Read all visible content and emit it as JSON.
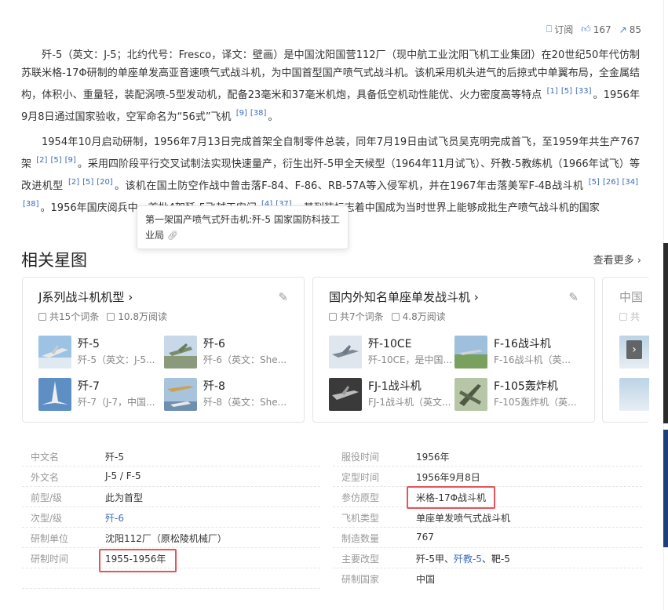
{
  "actions": {
    "subscribe": "订阅",
    "likes": "167",
    "shares": "85"
  },
  "para1": {
    "text_a": "歼-5（英文：J-5；北约代号：Fresco，译文：壁画）是中国沈阳国营112厂（现中航工业沈阳飞机工业集团）在20世纪50年代仿制苏联米格-17Φ研制的单座单发高亚音速喷气式战斗机，为中国首型国产喷气式战斗机。该机采用机头进气的后掠式中单翼布局，全金属结构，体积小、重量轻，装配涡喷-5型发动机，配备23毫米和37毫米机炮，具备低空机动性能优、火力密度高等特点",
    "refs_a": [
      "[1]",
      "[5]",
      "[33]"
    ],
    "text_b": "。1956年9月8日通过国家验收，空军命名为“56式”飞机",
    "refs_b": [
      "[9]",
      "[38]"
    ],
    "text_c": "。"
  },
  "para2": {
    "text_a": "1954年10月启动研制，1956年7月13日完成首架全自制零件总装，同年7月19日由试飞员吴克明完成首飞，至1959年共生产767架",
    "refs_a": [
      "[2]",
      "[5]",
      "[9]"
    ],
    "text_b": "。采用四阶段平行交叉试制法实现快速量产，衍生出歼-5甲全天候型（1964年11月试飞）、歼教-5教练机（1966年试飞）等改进机型",
    "refs_b": [
      "[2]",
      "[5]",
      "[20]"
    ],
    "text_c": "。该机在国土防空作战中曾击落F-84、F-86、RB-57A等入侵军机，并在1967年击落美军F-4B战斗机",
    "refs_c": [
      "[5]",
      "[26]",
      "[34]",
      "[38]"
    ],
    "text_d": "。1956年国庆阅兵中，首批4架歼-5飞越天安门",
    "refs_d": [
      "[4]",
      "[37]"
    ],
    "text_e": "，其列装标志着中国成为当时世界上能够成批生产喷气战斗机的国家"
  },
  "tooltip": {
    "text": "第一架国产喷气式歼击机:歼-5 国家国防科技工业局"
  },
  "related": {
    "title": "相关星图",
    "more": "查看更多",
    "cards": [
      {
        "title": "J系列战斗机机型",
        "entries_count": "共15个词条",
        "reads": "10.8万阅读",
        "items": [
          {
            "title": "歼-5",
            "desc": "歼-5（英文：J-5..."
          },
          {
            "title": "歼-6",
            "desc": "歼-6（英文：She..."
          },
          {
            "title": "歼-7",
            "desc": "歼-7（J-7，中国..."
          },
          {
            "title": "歼-8",
            "desc": "歼-8（英文：She..."
          }
        ]
      },
      {
        "title": "国内外知名单座单发战斗机",
        "entries_count": "共7个词条",
        "reads": "4.8万阅读",
        "items": [
          {
            "title": "歼-10CE",
            "desc": "歼-10CE，是中国..."
          },
          {
            "title": "F-16战斗机",
            "desc": "F-16战斗机（英..."
          },
          {
            "title": "FJ-1战斗机",
            "desc": "FJ-1战斗机（英文..."
          },
          {
            "title": "F-105轰炸机",
            "desc": "F-105轰炸机（英..."
          }
        ]
      },
      {
        "title": "中国",
        "entries_count": "共"
      }
    ]
  },
  "info": {
    "left": [
      {
        "k": "中文名",
        "v": "歼-5"
      },
      {
        "k": "外文名",
        "v": "J-5 / F-5"
      },
      {
        "k": "前型/级",
        "v": "此为首型"
      },
      {
        "k": "次型/级",
        "v": "歼-6",
        "link": true
      },
      {
        "k": "研制单位",
        "v": "沈阳112厂（原松陵机械厂）"
      },
      {
        "k": "研制时间",
        "v": "1955-1956年"
      }
    ],
    "right": [
      {
        "k": "服役时间",
        "v": "1956年"
      },
      {
        "k": "定型时间",
        "v": "1956年9月8日"
      },
      {
        "k": "参仿原型",
        "v": "米格-17Φ战斗机"
      },
      {
        "k": "飞机类型",
        "v": "单座单发喷气式战斗机"
      },
      {
        "k": "制造数量",
        "v": "767"
      },
      {
        "k": "主要改型",
        "v_a": "歼-5甲、",
        "v_link": "歼教-5",
        "v_b": "、靶-5"
      },
      {
        "k": "研制国家",
        "v": "中国"
      }
    ]
  },
  "colors": {
    "link": "#3d6cb5",
    "highlight": "#e8535a"
  }
}
